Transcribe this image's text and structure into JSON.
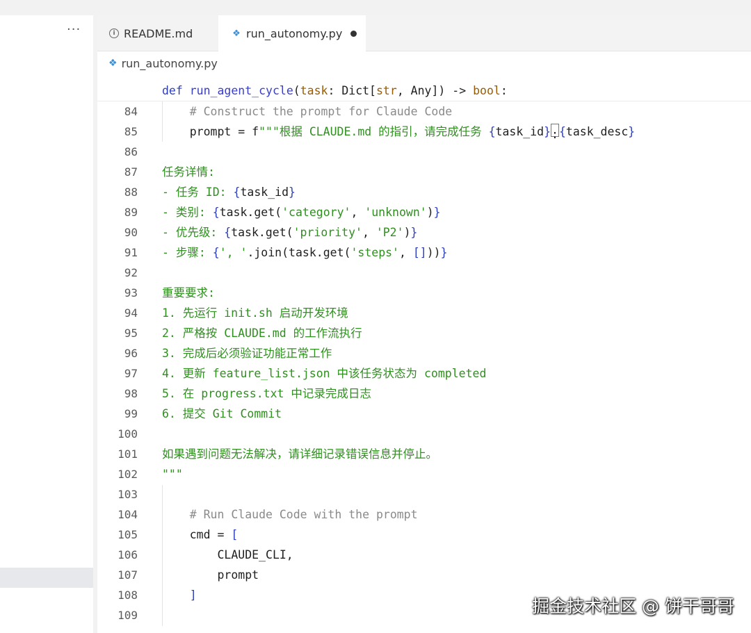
{
  "sidebar": {
    "more_label": "···"
  },
  "tabs": [
    {
      "label": "README.md",
      "icon": "info-icon",
      "active": false
    },
    {
      "label": "run_autonomy.py",
      "icon": "python-icon",
      "active": true,
      "modified": true
    }
  ],
  "breadcrumb": {
    "file": "run_autonomy.py"
  },
  "sticky_header": {
    "def": "def",
    "name": "run_agent_cycle",
    "open": "(",
    "param": "task",
    "rest_a": ": Dict[",
    "str": "str",
    "rest_b": ", Any]) -> ",
    "bool": "bool",
    "end": ":"
  },
  "lines": [
    {
      "n": "84",
      "segments": [
        {
          "c": "cm",
          "t": "    # Construct the prompt for Claude Code"
        }
      ]
    },
    {
      "n": "85",
      "segments": [
        {
          "c": "",
          "t": "    prompt = f"
        },
        {
          "c": "str",
          "t": "\"\"\"根据 CLAUDE.md 的指引，请完成任务 "
        },
        {
          "c": "br",
          "t": "{"
        },
        {
          "c": "",
          "t": "task_id"
        },
        {
          "c": "br",
          "t": "}"
        },
        {
          "c": "caret",
          "t": ":"
        },
        {
          "c": "br",
          "t": "{"
        },
        {
          "c": "",
          "t": "task_desc"
        },
        {
          "c": "br",
          "t": "}"
        }
      ]
    },
    {
      "n": "86",
      "segments": []
    },
    {
      "n": "87",
      "segments": [
        {
          "c": "str",
          "t": "任务详情:"
        }
      ]
    },
    {
      "n": "88",
      "segments": [
        {
          "c": "str",
          "t": "- 任务 ID: "
        },
        {
          "c": "br",
          "t": "{"
        },
        {
          "c": "",
          "t": "task_id"
        },
        {
          "c": "br",
          "t": "}"
        }
      ]
    },
    {
      "n": "89",
      "segments": [
        {
          "c": "str",
          "t": "- 类别: "
        },
        {
          "c": "br",
          "t": "{"
        },
        {
          "c": "",
          "t": "task.get("
        },
        {
          "c": "str",
          "t": "'category'"
        },
        {
          "c": "",
          "t": ", "
        },
        {
          "c": "str",
          "t": "'unknown'"
        },
        {
          "c": "",
          "t": ")"
        },
        {
          "c": "br",
          "t": "}"
        }
      ]
    },
    {
      "n": "90",
      "segments": [
        {
          "c": "str",
          "t": "- 优先级: "
        },
        {
          "c": "br",
          "t": "{"
        },
        {
          "c": "",
          "t": "task.get("
        },
        {
          "c": "str",
          "t": "'priority'"
        },
        {
          "c": "",
          "t": ", "
        },
        {
          "c": "str",
          "t": "'P2'"
        },
        {
          "c": "",
          "t": ")"
        },
        {
          "c": "br",
          "t": "}"
        }
      ]
    },
    {
      "n": "91",
      "segments": [
        {
          "c": "str",
          "t": "- 步骤: "
        },
        {
          "c": "br",
          "t": "{"
        },
        {
          "c": "str",
          "t": "', '"
        },
        {
          "c": "",
          "t": ".join(task.get("
        },
        {
          "c": "str",
          "t": "'steps'"
        },
        {
          "c": "",
          "t": ", "
        },
        {
          "c": "br",
          "t": "[]"
        },
        {
          "c": "",
          "t": "))"
        },
        {
          "c": "br",
          "t": "}"
        }
      ]
    },
    {
      "n": "92",
      "segments": []
    },
    {
      "n": "93",
      "segments": [
        {
          "c": "str",
          "t": "重要要求:"
        }
      ]
    },
    {
      "n": "94",
      "segments": [
        {
          "c": "str",
          "t": "1. 先运行 init.sh 启动开发环境"
        }
      ]
    },
    {
      "n": "95",
      "segments": [
        {
          "c": "str",
          "t": "2. 严格按 CLAUDE.md 的工作流执行"
        }
      ]
    },
    {
      "n": "96",
      "segments": [
        {
          "c": "str",
          "t": "3. 完成后必须验证功能正常工作"
        }
      ]
    },
    {
      "n": "97",
      "segments": [
        {
          "c": "str",
          "t": "4. 更新 feature_list.json 中该任务状态为 completed"
        }
      ]
    },
    {
      "n": "98",
      "segments": [
        {
          "c": "str",
          "t": "5. 在 progress.txt 中记录完成日志"
        }
      ]
    },
    {
      "n": "99",
      "segments": [
        {
          "c": "str",
          "t": "6. 提交 Git Commit"
        }
      ]
    },
    {
      "n": "100",
      "segments": []
    },
    {
      "n": "101",
      "segments": [
        {
          "c": "str",
          "t": "如果遇到问题无法解决，请详细记录错误信息并停止。"
        }
      ]
    },
    {
      "n": "102",
      "segments": [
        {
          "c": "str",
          "t": "\"\"\""
        }
      ]
    },
    {
      "n": "103",
      "segments": []
    },
    {
      "n": "104",
      "segments": [
        {
          "c": "cm",
          "t": "    # Run Claude Code with the prompt"
        }
      ]
    },
    {
      "n": "105",
      "segments": [
        {
          "c": "",
          "t": "    cmd = "
        },
        {
          "c": "br",
          "t": "["
        }
      ]
    },
    {
      "n": "106",
      "segments": [
        {
          "c": "",
          "t": "        CLAUDE_CLI,"
        }
      ]
    },
    {
      "n": "107",
      "segments": [
        {
          "c": "",
          "t": "        prompt"
        }
      ]
    },
    {
      "n": "108",
      "segments": [
        {
          "c": "br",
          "t": "    ]"
        }
      ]
    },
    {
      "n": "109",
      "segments": []
    }
  ],
  "watermark": "掘金技术社区 @ 饼干哥哥"
}
